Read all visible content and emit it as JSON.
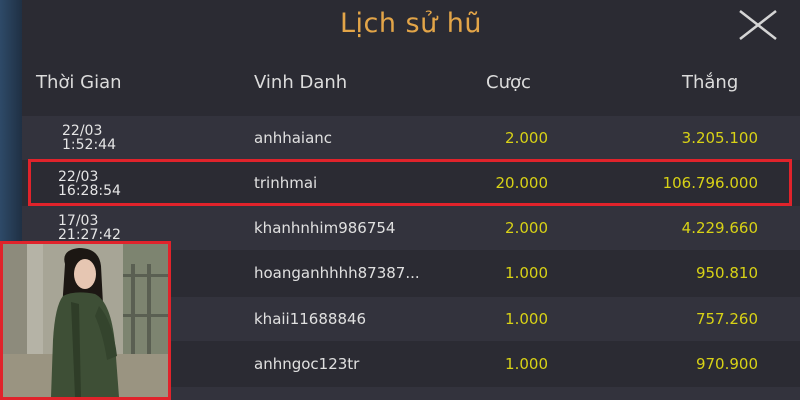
{
  "dialog": {
    "title": "Lịch sử hũ",
    "close_icon": "close-icon"
  },
  "columns": {
    "time": "Thời Gian",
    "name": "Vinh Danh",
    "bet": "Cược",
    "win": "Thắng"
  },
  "rows": [
    {
      "date": "22/03",
      "time": "1:52:44",
      "name": "anhhaianc",
      "bet": "2.000",
      "win": "3.205.100"
    },
    {
      "date": "22/03",
      "time": "16:28:54",
      "name": "trinhmai",
      "bet": "20.000",
      "win": "106.796.000"
    },
    {
      "date": "17/03",
      "time": "21:27:42",
      "name": "khanhnhim986754",
      "bet": "2.000",
      "win": "4.229.660"
    },
    {
      "date": "",
      "time": "",
      "name": "hoanganhhhh87387...",
      "bet": "1.000",
      "win": "950.810"
    },
    {
      "date": "",
      "time": "",
      "name": "khaii11688846",
      "bet": "1.000",
      "win": "757.260"
    },
    {
      "date": "",
      "time": "",
      "name": "anhngoc123tr",
      "bet": "1.000",
      "win": "970.900"
    }
  ],
  "colors": {
    "title": "#e3a548",
    "amount": "#d8d216",
    "highlight_border": "#e0232b",
    "panel_bg": "#2b2b33"
  }
}
